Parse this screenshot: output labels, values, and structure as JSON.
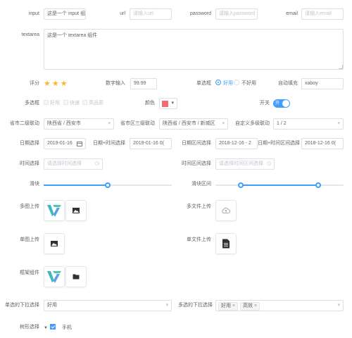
{
  "input": {
    "label": "input",
    "value": "这是一个 input 组件"
  },
  "url": {
    "label": "url",
    "placeholder": "请输入url"
  },
  "password": {
    "label": "password",
    "placeholder": "请输入password"
  },
  "email": {
    "label": "email",
    "placeholder": "请输入email"
  },
  "textarea": {
    "label": "textarea",
    "value": "这是一个 textarea 组件"
  },
  "rating": {
    "label": "评分",
    "stars": "★★★",
    "value": 3
  },
  "number": {
    "label": "数字输入",
    "value": "99.99"
  },
  "radio": {
    "label": "单选框",
    "options": [
      "好用",
      "不好用"
    ],
    "selected": "好用"
  },
  "autocomplete": {
    "label": "自动填充",
    "value": "xaboy"
  },
  "checkbox": {
    "label": "多选框",
    "options": [
      "好用",
      "快速",
      "高品质"
    ]
  },
  "color": {
    "label": "颜色",
    "value": "#f56c6c"
  },
  "switch": {
    "label": "开关",
    "text": "开"
  },
  "city2": {
    "label": "省市二级联动",
    "value": "陕西省 / 西安市"
  },
  "city3": {
    "label": "省市区三级联动",
    "value": "陕西省 / 西安市 / 新城区"
  },
  "cascader": {
    "label": "自定义多级联动",
    "value": "1 / 2"
  },
  "date": {
    "label": "日期选择",
    "value": "2019-01-16"
  },
  "datetime": {
    "label": "日期+时间选择",
    "value": "2019-01-16 0("
  },
  "daterange": {
    "label": "日期区间选择",
    "value": "2018-12-16 - 2"
  },
  "datetimerange": {
    "label": "日期+时间区间选择",
    "value": "2018-12-16 0("
  },
  "time": {
    "label": "时间选择",
    "placeholder": "请选择时间选择"
  },
  "timerange": {
    "label": "时间区间选择",
    "placeholder": "请选择时间区间选择"
  },
  "slider": {
    "label": "滑块",
    "value": 0.5
  },
  "sliderrange": {
    "label": "滑块区间",
    "from": 0.2,
    "to": 0.8
  },
  "upload_images": {
    "label": "多图上传"
  },
  "upload_files": {
    "label": "多文件上传"
  },
  "upload_image": {
    "label": "单图上传"
  },
  "upload_file": {
    "label": "单文件上传"
  },
  "frame": {
    "label": "框架组件"
  },
  "select": {
    "label": "单选的下拉选择",
    "value": "好用"
  },
  "multiselect": {
    "label": "多选的下拉选择",
    "tags": [
      "好用",
      "高效"
    ]
  },
  "tree": {
    "label": "树形选择",
    "node": "手机"
  },
  "colors": {
    "accent": "#409eff",
    "star": "#f7ba2a",
    "border": "#dcdfe6"
  }
}
